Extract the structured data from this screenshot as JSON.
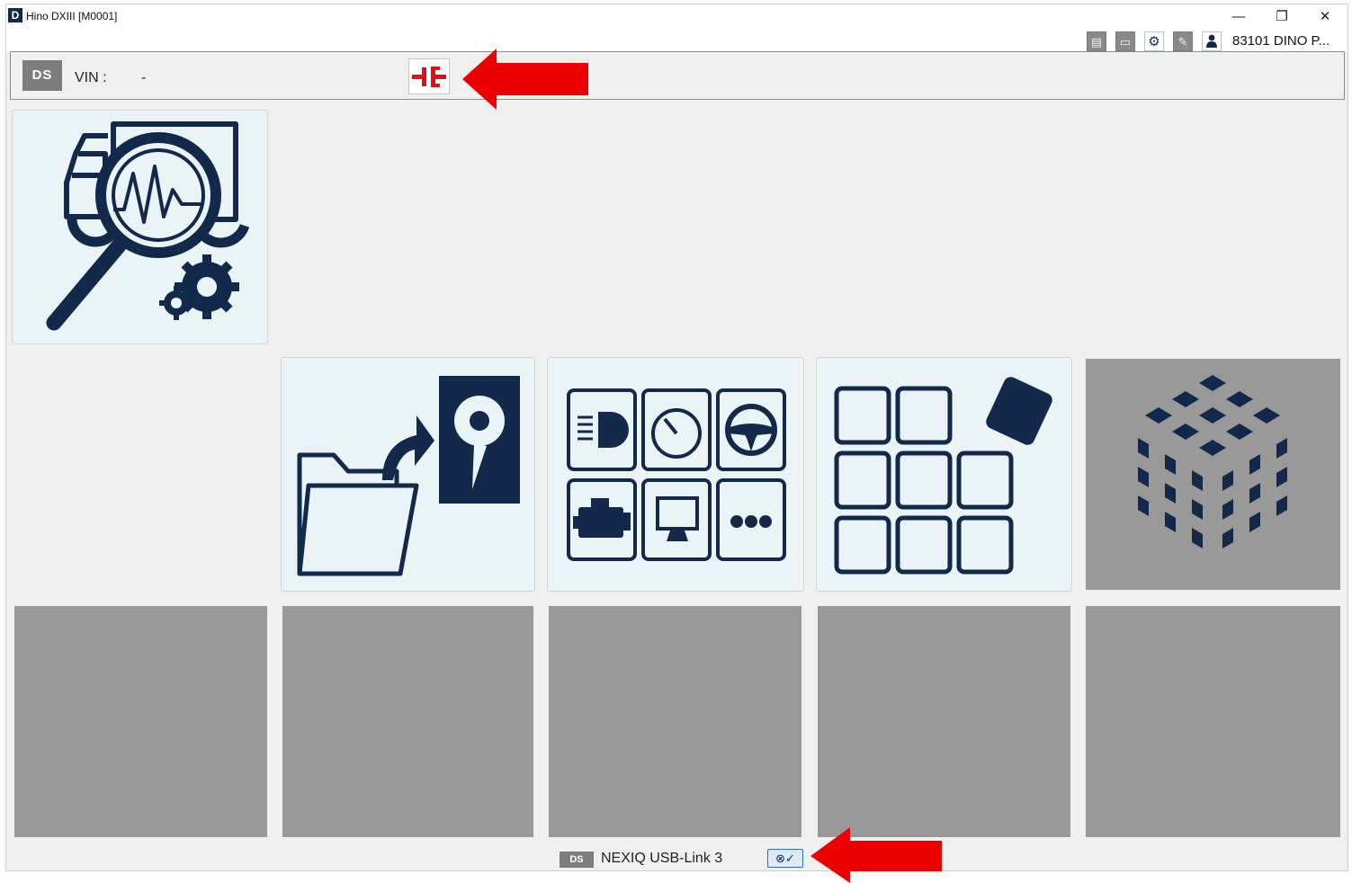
{
  "window": {
    "app_logo": "D",
    "title": "Hino DXIII [M0001]",
    "controls": {
      "minimize": "—",
      "restore": "❐",
      "close": "✕"
    }
  },
  "toolbar": {
    "icons": [
      "print-preview-icon",
      "printer-icon",
      "settings-icon",
      "edit-icon",
      "user-icon"
    ],
    "user_name": "83101 DINO P..."
  },
  "vin_bar": {
    "logo": "DS",
    "label": "VIN :",
    "value": "-",
    "connect_icon": "disconnected-plug-icon"
  },
  "tiles": [
    {
      "name": "diagnosis-tile",
      "icon": "truck-diagnosis-icon",
      "state": "enabled"
    },
    {
      "name": "data-import-tile",
      "icon": "folder-to-disk-icon",
      "state": "enabled"
    },
    {
      "name": "function-menu-tile",
      "icon": "vehicle-functions-icon",
      "state": "enabled"
    },
    {
      "name": "custom-layout-tile",
      "icon": "grid-blocks-icon",
      "state": "enabled"
    },
    {
      "name": "cube-tile",
      "icon": "cube-icon",
      "state": "disabled"
    },
    {
      "name": "empty-tile-1",
      "icon": "",
      "state": "disabled"
    },
    {
      "name": "empty-tile-2",
      "icon": "",
      "state": "disabled"
    },
    {
      "name": "empty-tile-3",
      "icon": "",
      "state": "disabled"
    },
    {
      "name": "empty-tile-4",
      "icon": "",
      "state": "disabled"
    },
    {
      "name": "empty-tile-5",
      "icon": "",
      "state": "disabled"
    }
  ],
  "status_bar": {
    "logo": "DS",
    "interface_name": "NEXIQ USB-Link 3",
    "connection_icon": "interface-connected-icon"
  },
  "colors": {
    "brand_navy": "#13294b",
    "tile_background": "#eaf4f7",
    "disabled_tile": "#999999",
    "callout_red": "#ee0000",
    "connect_red": "#e0101a"
  }
}
